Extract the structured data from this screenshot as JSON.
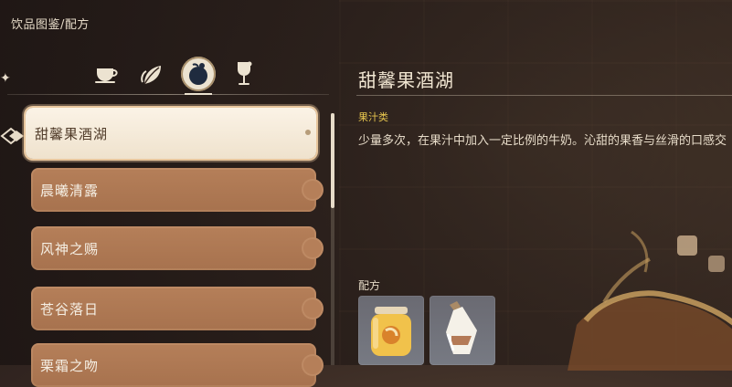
{
  "breadcrumb": "饮品图鉴/配方",
  "tabs": [
    {
      "icon": "teacup-icon",
      "active": false
    },
    {
      "icon": "tea-leaf-icon",
      "active": false
    },
    {
      "icon": "fruit-icon",
      "active": true
    },
    {
      "icon": "wine-glass-icon",
      "active": false
    }
  ],
  "list": {
    "items": [
      {
        "label": "甜馨果酒湖",
        "selected": true
      },
      {
        "label": "晨曦清露",
        "selected": false
      },
      {
        "label": "风神之赐",
        "selected": false
      },
      {
        "label": "苍谷落日",
        "selected": false
      },
      {
        "label": "栗霜之吻",
        "selected": false
      }
    ]
  },
  "detail": {
    "title": "甜馨果酒湖",
    "category": "果汁类",
    "description": "少量多次，在果汁中加入一定比例的牛奶。沁甜的果香与丝滑的口感交",
    "recipe_label": "配方",
    "ingredients": [
      {
        "icon": "jam-jar-icon"
      },
      {
        "icon": "milk-bottle-icon"
      }
    ]
  },
  "colors": {
    "accent_yellow": "#e7c64f",
    "item_brown": "#b57f59",
    "item_selected": "#f7efdf"
  }
}
